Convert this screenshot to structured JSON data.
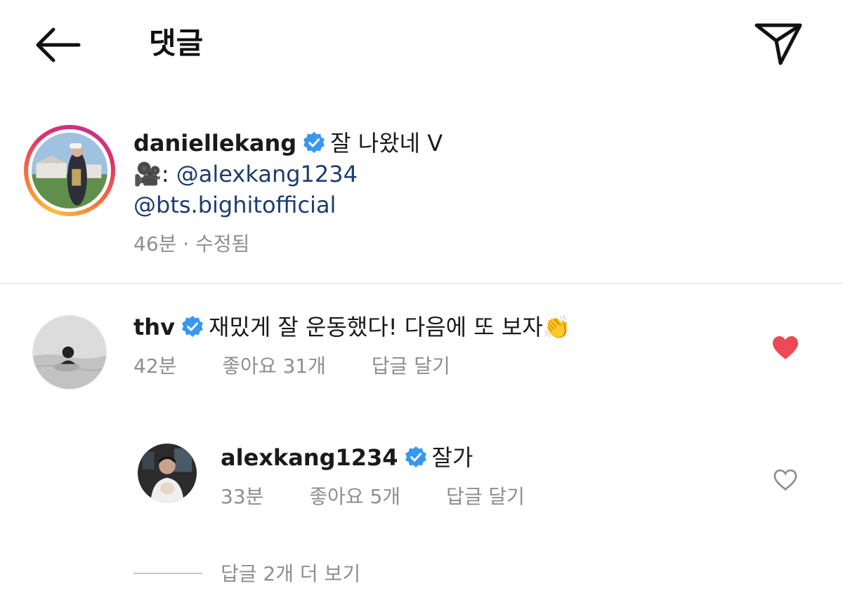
{
  "header": {
    "title": "댓글",
    "back_icon": "arrow-left-icon",
    "share_icon": "paper-plane-icon"
  },
  "caption": {
    "username": "daniellekang",
    "verified": true,
    "text": "잘 나왔네 V",
    "camera_emoji": "🎥",
    "line2_prefix": ": ",
    "mention1": "@alexkang1234",
    "mention2": "@bts.bighitofficial",
    "time": "46분",
    "separator": "·",
    "edited": "수정됨"
  },
  "comments": [
    {
      "username": "thv",
      "verified": true,
      "text": "재밌게 잘 운동했다! 다음에 또 보자",
      "emoji": "👏",
      "time": "42분",
      "likes": "좋아요 31개",
      "reply_label": "답글 달기",
      "liked": true
    }
  ],
  "replies": [
    {
      "username": "alexkang1234",
      "verified": true,
      "text": "잘가",
      "time": "33분",
      "likes": "좋아요 5개",
      "reply_label": "답글 달기",
      "liked": false
    }
  ],
  "view_more_replies": "답글 2개 더 보기",
  "colors": {
    "verified_blue": "#3897f0",
    "heart_red": "#ed4956",
    "mention": "#1c3d6e",
    "meta_gray": "#8e8e8e"
  }
}
